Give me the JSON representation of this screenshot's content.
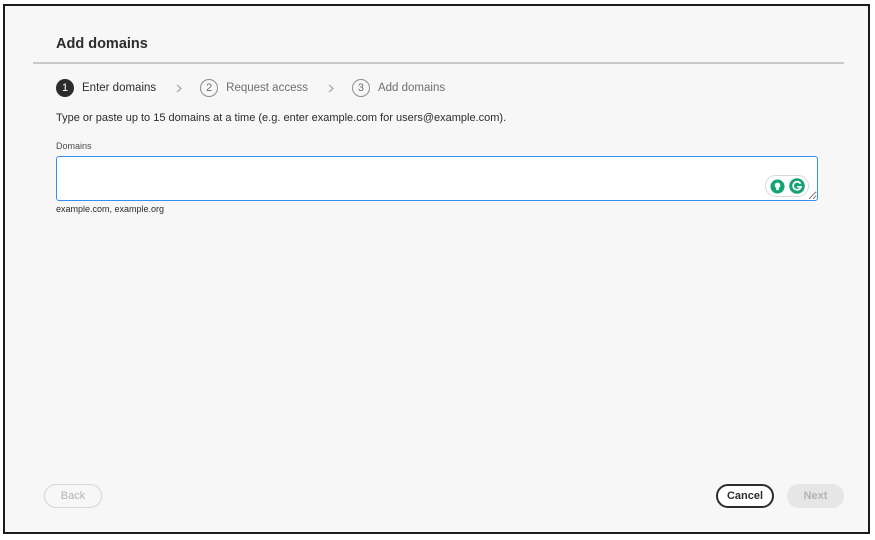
{
  "dialog": {
    "title": "Add domains"
  },
  "stepper": {
    "steps": [
      {
        "number": "1",
        "label": "Enter domains",
        "state": "active"
      },
      {
        "number": "2",
        "label": "Request access",
        "state": "inactive"
      },
      {
        "number": "3",
        "label": "Add domains",
        "state": "inactive"
      }
    ]
  },
  "form": {
    "description": "Type or paste up to 15 domains at a time (e.g. enter example.com for users@example.com).",
    "domains_label": "Domains",
    "domains_value": "",
    "help_text": "example.com, example.org",
    "extension_icons": [
      "lightbulb-icon",
      "grammarly-icon"
    ]
  },
  "footer": {
    "back_label": "Back",
    "cancel_label": "Cancel",
    "next_label": "Next"
  },
  "colors": {
    "input_focus_border": "#378ef0",
    "active_step": "#2c2c2c",
    "extension_green": "#15a373"
  }
}
